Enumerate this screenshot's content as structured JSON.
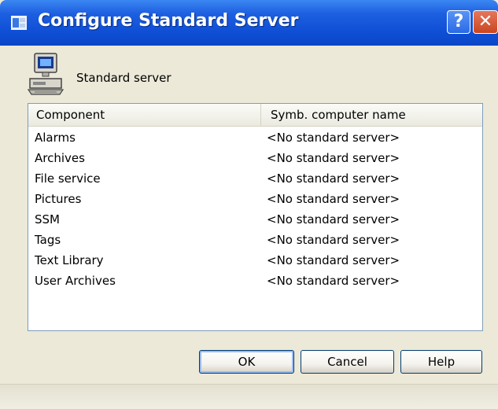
{
  "window": {
    "title": "Configure Standard Server",
    "help_glyph": "?",
    "close_glyph": "✕"
  },
  "header": {
    "label": "Standard server",
    "icon": "computer-icon"
  },
  "list": {
    "columns": [
      "Component",
      "Symb. computer name"
    ],
    "rows": [
      {
        "component": "Alarms",
        "computer": "<No standard server>"
      },
      {
        "component": "Archives",
        "computer": "<No standard server>"
      },
      {
        "component": "File service",
        "computer": "<No standard server>"
      },
      {
        "component": "Pictures",
        "computer": "<No standard server>"
      },
      {
        "component": "SSM",
        "computer": "<No standard server>"
      },
      {
        "component": "Tags",
        "computer": "<No standard server>"
      },
      {
        "component": "Text Library",
        "computer": "<No standard server>"
      },
      {
        "component": "User Archives",
        "computer": "<No standard server>"
      }
    ]
  },
  "buttons": {
    "ok": "OK",
    "cancel": "Cancel",
    "help": "Help"
  },
  "colors": {
    "titlebar": "#0a46c6",
    "dialog_bg": "#ece9d8",
    "close_button": "#c9461f"
  }
}
